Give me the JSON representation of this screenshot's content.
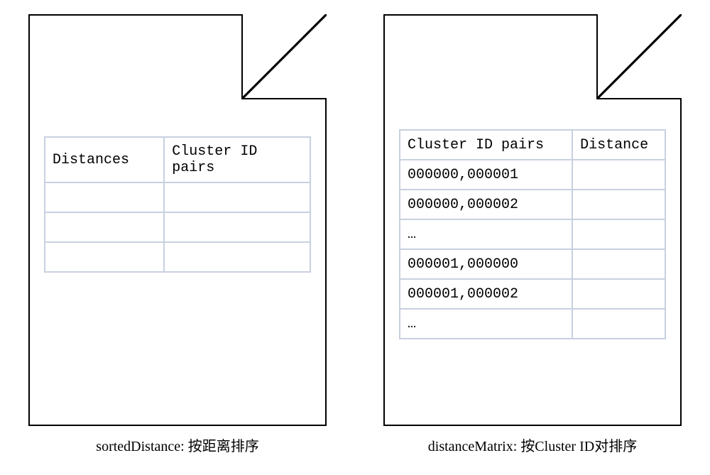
{
  "left": {
    "caption_prefix": "sortedDistance: ",
    "caption_text": "按距离排序",
    "table": {
      "headers": [
        "Distances",
        "Cluster ID pairs"
      ],
      "rows": [
        [
          "",
          ""
        ],
        [
          "",
          ""
        ],
        [
          "",
          ""
        ]
      ]
    }
  },
  "right": {
    "caption_prefix": "distanceMatrix: ",
    "caption_text": "按Cluster ID对排序",
    "table": {
      "headers": [
        "Cluster ID pairs",
        "Distance"
      ],
      "rows": [
        [
          "000000,000001",
          ""
        ],
        [
          "000000,000002",
          ""
        ],
        [
          "…",
          ""
        ],
        [
          "000001,000000",
          ""
        ],
        [
          "000001,000002",
          ""
        ],
        [
          "…",
          ""
        ]
      ]
    }
  }
}
